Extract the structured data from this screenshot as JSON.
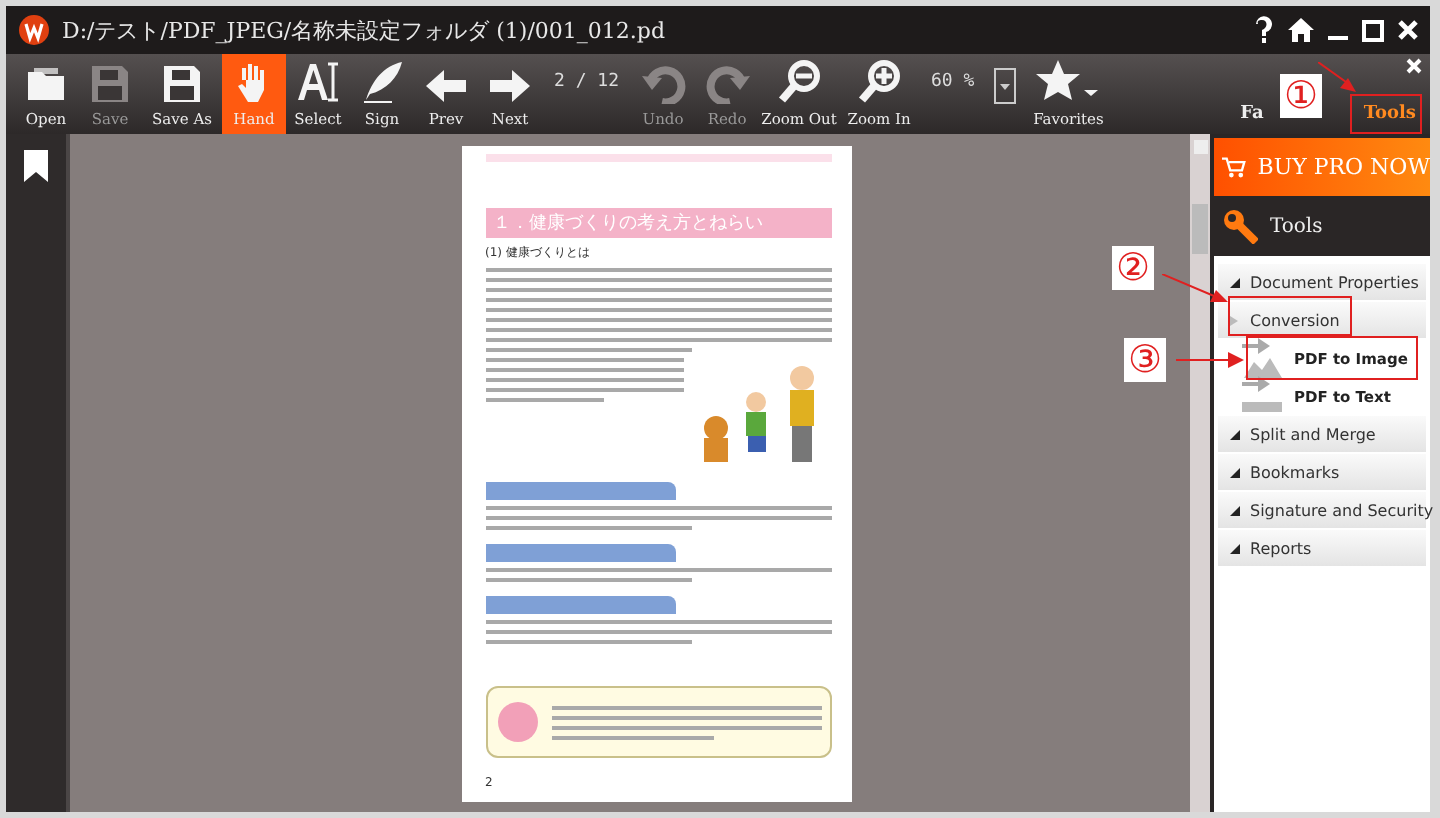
{
  "window": {
    "title": "D:/テスト/PDF_JPEG/名称未設定フォルダ (1)/001_012.pd"
  },
  "toolbar": [
    {
      "kind": "button",
      "label": "Open",
      "selected": false,
      "disabled": false
    },
    {
      "kind": "button",
      "label": "Save",
      "selected": false,
      "disabled": true
    },
    {
      "kind": "button",
      "label": "Save As",
      "selected": false,
      "disabled": false
    },
    {
      "kind": "button",
      "label": "Hand",
      "selected": true,
      "disabled": false
    },
    {
      "kind": "button",
      "label": "Select",
      "selected": false,
      "disabled": false
    },
    {
      "kind": "button",
      "label": "Sign",
      "selected": false,
      "disabled": false
    },
    {
      "kind": "button",
      "label": "Prev",
      "selected": false,
      "disabled": false
    },
    {
      "kind": "button",
      "label": "Next",
      "selected": false,
      "disabled": false
    },
    {
      "kind": "text",
      "text": "2 / 12"
    },
    {
      "kind": "button",
      "label": "Undo",
      "selected": false,
      "disabled": true
    },
    {
      "kind": "button",
      "label": "Redo",
      "selected": false,
      "disabled": true
    },
    {
      "kind": "button",
      "label": "Zoom Out",
      "selected": false,
      "disabled": false
    },
    {
      "kind": "button",
      "label": "Zoom In",
      "selected": false,
      "disabled": false
    },
    {
      "kind": "text",
      "text": "60 %"
    },
    {
      "kind": "dropdown"
    },
    {
      "kind": "button",
      "label": "Favorites",
      "selected": false,
      "disabled": false
    }
  ],
  "panel_tabs": [
    {
      "label": "Fa",
      "selected": false
    },
    {
      "label": "Tools",
      "selected": true
    }
  ],
  "document": {
    "title": "１．健康づくりの考え方とねらい",
    "subtitle": "(1) 健康づくりとは",
    "page_number": "2"
  },
  "side_panel": {
    "buy_button": "BUY PRO NOW",
    "header": "Tools",
    "sections": [
      {
        "label": "Document Properties",
        "expanded": false
      },
      {
        "label": "Conversion",
        "expanded": true,
        "children": [
          {
            "label": "PDF to Image"
          },
          {
            "label": "PDF to Text"
          }
        ]
      },
      {
        "label": "Split and Merge",
        "expanded": false
      },
      {
        "label": "Bookmarks",
        "expanded": false
      },
      {
        "label": "Signature and Security",
        "expanded": false
      },
      {
        "label": "Reports",
        "expanded": false
      }
    ]
  },
  "annotations": [
    {
      "label": "①"
    },
    {
      "label": "②"
    },
    {
      "label": "③"
    }
  ]
}
